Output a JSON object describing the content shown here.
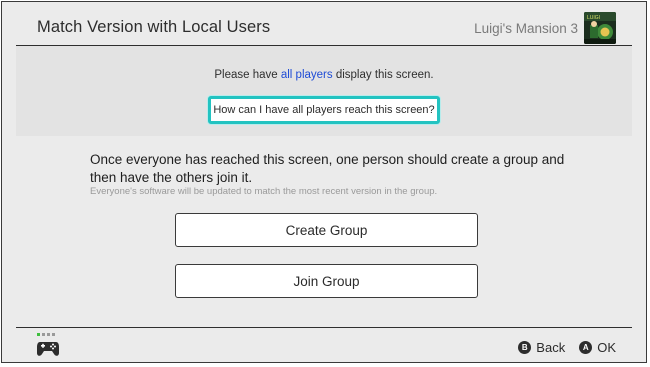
{
  "header": {
    "title": "Match Version with Local Users",
    "game_name": "Luigi's Mansion 3",
    "game_icon": "luigis-mansion-3-cover-icon"
  },
  "info": {
    "prefix": "Please have ",
    "link": "all players",
    "suffix": " display this screen.",
    "help_button": "How can I have all players reach this screen?"
  },
  "main": {
    "instruction": "Once everyone has reached this screen, one person should create a group and then have the others join it.",
    "note": "Everyone's software will be updated to match the most recent version in the group.",
    "create_group": "Create Group",
    "join_group": "Join Group"
  },
  "footer": {
    "controller_icon": "controller-icon",
    "back_glyph": "B",
    "back_label": "Back",
    "ok_glyph": "A",
    "ok_label": "OK"
  },
  "colors": {
    "accent_link": "#1f4cd6",
    "focus_border": "#23c3c1",
    "background": "#ebebeb"
  }
}
